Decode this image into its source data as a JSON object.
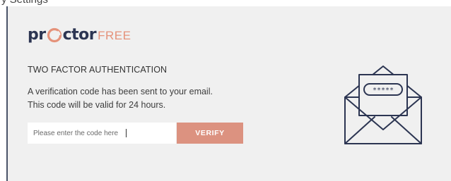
{
  "header_fragment": "y Settings",
  "brand": {
    "name_left": "pr",
    "name_right": "ctor",
    "name_suffix": "FREE",
    "primary_color": "#2c3552",
    "accent_color": "#e5927a"
  },
  "auth": {
    "heading": "TWO FACTOR AUTHENTICATION",
    "message_line1": "A verification code has been sent to your email.",
    "message_line2": "This code will be valid for 24 hours.",
    "input_placeholder": "Please enter the code here",
    "input_value": "",
    "verify_label": "VERIFY",
    "verify_color": "#dc9280",
    "code_mask": "*****"
  },
  "icons": {
    "logo_mark": "camera-lens-o-icon",
    "envelope": "envelope-with-code-icon"
  }
}
